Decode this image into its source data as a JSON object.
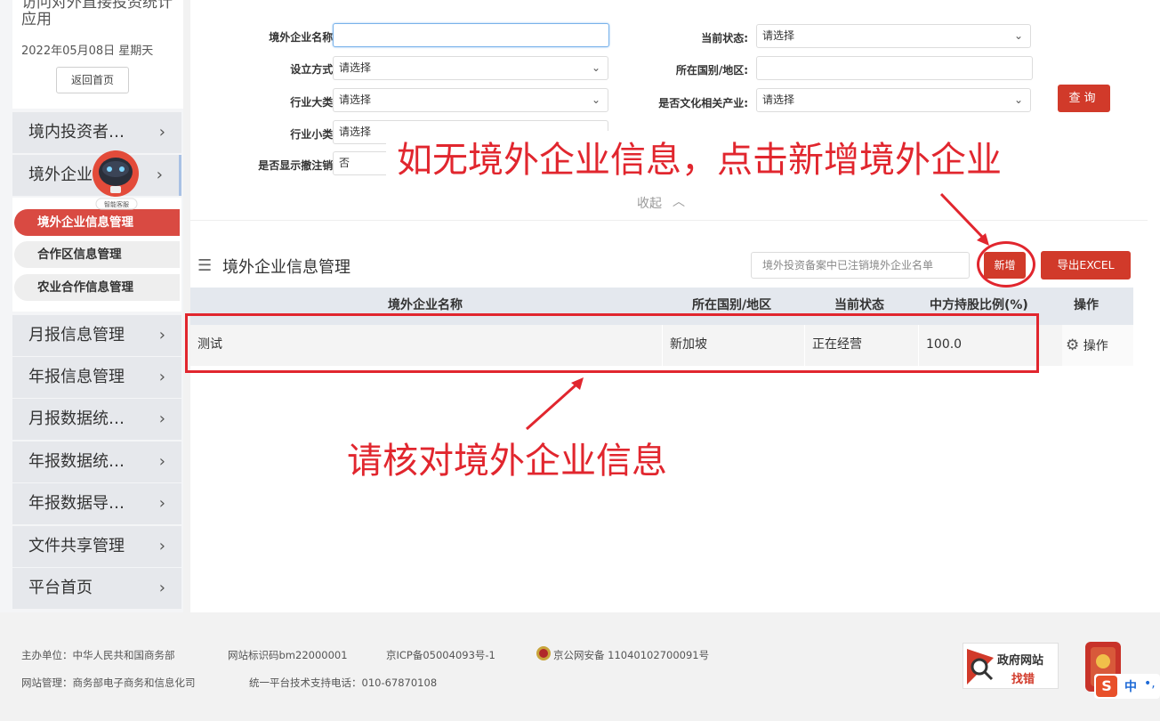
{
  "sidebar": {
    "title": "访问对外直接投资统计应用",
    "date": "2022年05月08日 星期天",
    "home_button": "返回首页",
    "robot_label": "智能客服",
    "menu": [
      {
        "label": "境内投资者…"
      },
      {
        "label": "境外企业"
      },
      {
        "label": "月报信息管理"
      },
      {
        "label": "年报信息管理"
      },
      {
        "label": "月报数据统…"
      },
      {
        "label": "年报数据统…"
      },
      {
        "label": "年报数据导…"
      },
      {
        "label": "文件共享管理"
      },
      {
        "label": "平台首页"
      }
    ],
    "submenu": [
      {
        "label": "境外企业信息管理",
        "active": true
      },
      {
        "label": "合作区信息管理",
        "active": false
      },
      {
        "label": "农业合作信息管理",
        "active": false
      }
    ]
  },
  "form": {
    "company_name_label": "境外企业名称:",
    "company_name_value": "",
    "setup_method_label": "设立方式:",
    "setup_method_value": "请选择",
    "industry_major_label": "行业大类:",
    "industry_major_value": "请选择",
    "industry_minor_label": "行业小类:",
    "industry_minor_value": "请选择",
    "show_cancelled_label": "是否显示撤注销:",
    "show_cancelled_value": "否",
    "status_label": "当前状态:",
    "status_value": "请选择",
    "country_label": "所在国别/地区:",
    "country_value": "",
    "cultural_label": "是否文化相关产业:",
    "cultural_value": "请选择",
    "query_button": "查询",
    "collapse_label": "收起"
  },
  "section": {
    "title": "境外企业信息管理",
    "search_placeholder": "境外投资备案中已注销境外企业名单",
    "add_button": "新增",
    "export_button": "导出EXCEL"
  },
  "table": {
    "headers": [
      "境外企业名称",
      "所在国别/地区",
      "当前状态",
      "中方持股比例(%)",
      "操作"
    ],
    "rows": [
      {
        "name": "测试",
        "country": "新加坡",
        "status": "正在经营",
        "ratio": "100.0",
        "action": "操作"
      }
    ]
  },
  "footer": {
    "host": "主办单位：中华人民共和国商务部",
    "site_id": "网站标识码bm22000001",
    "icp": "京ICP备05004093号-1",
    "police": "京公网安备 11040102700091号",
    "manager": "网站管理：商务部电子商务和信息化司",
    "support": "统一平台技术支持电话：010-67870108",
    "gov_badge_1": "政府网站",
    "gov_badge_2": "找错"
  },
  "annotations": {
    "top": "如无境外企业信息，点击新增境外企业",
    "bottom": "请核对境外企业信息"
  },
  "ime": {
    "s": "S",
    "lang": "中",
    "punct": "•,"
  },
  "colors": {
    "primary_red": "#d13a2a",
    "annotation_red": "#e1262e",
    "active_submenu": "#d94a42"
  }
}
